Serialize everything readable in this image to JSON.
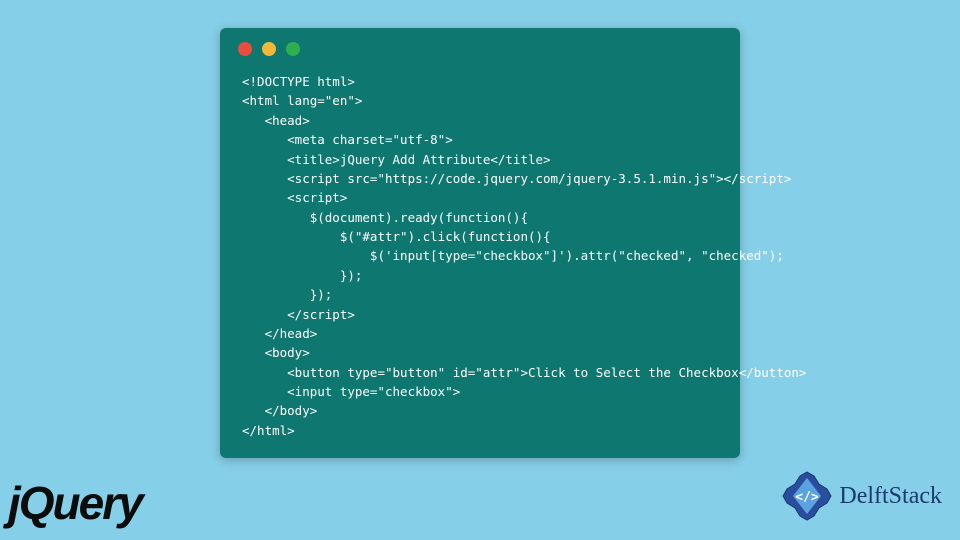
{
  "code_window": {
    "lines": [
      "<!DOCTYPE html>",
      "<html lang=\"en\">",
      "   <head>",
      "      <meta charset=\"utf-8\">",
      "      <title>jQuery Add Attribute</title>",
      "      <script src=\"https://code.jquery.com/jquery-3.5.1.min.js\"></script>",
      "      <script>",
      "         $(document).ready(function(){",
      "             $(\"#attr\").click(function(){",
      "                 $('input[type=\"checkbox\"]').attr(\"checked\", \"checked\");",
      "             });",
      "         });",
      "      </script>",
      "   </head>",
      "   <body>",
      "      <button type=\"button\" id=\"attr\">Click to Select the Checkbox</button>",
      "      <input type=\"checkbox\">",
      "   </body>",
      "</html>"
    ]
  },
  "logos": {
    "jquery": "jQuery",
    "delftstack": "DelftStack"
  },
  "colors": {
    "background": "#86cfe8",
    "window": "#0d7770",
    "dot_red": "#e84d3d",
    "dot_yellow": "#f0b93a",
    "dot_green": "#2fae4f"
  }
}
